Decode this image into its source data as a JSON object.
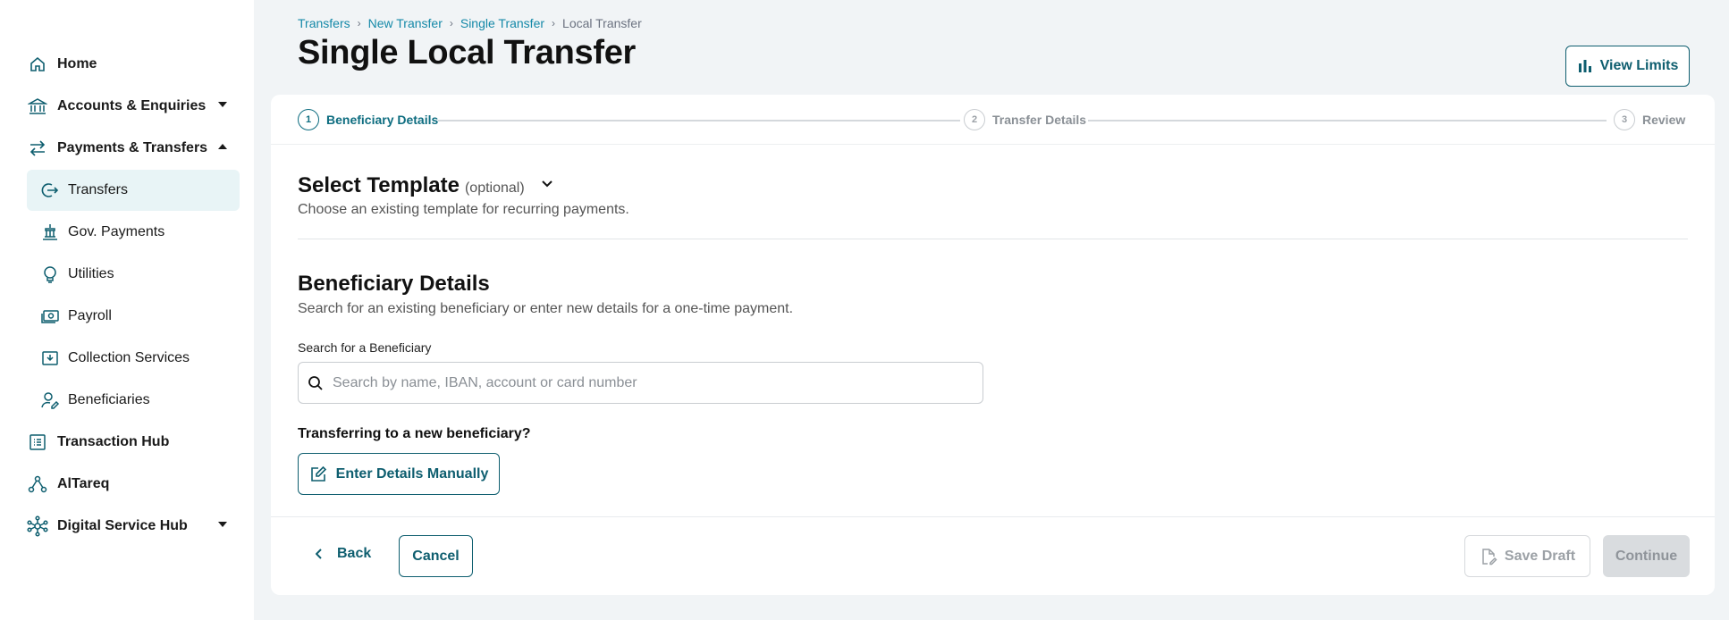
{
  "sidebar": {
    "items": [
      {
        "label": "Home",
        "icon": "home-icon"
      },
      {
        "label": "Accounts & Enquiries",
        "icon": "bank-icon"
      },
      {
        "label": "Payments & Transfers",
        "icon": "transfer-arrows-icon"
      },
      {
        "label": "Transfers",
        "icon": "transfer-circle-icon"
      },
      {
        "label": "Gov. Payments",
        "icon": "government-icon"
      },
      {
        "label": "Utilities",
        "icon": "lightbulb-icon"
      },
      {
        "label": "Payroll",
        "icon": "cash-icon"
      },
      {
        "label": "Collection Services",
        "icon": "collection-icon"
      },
      {
        "label": "Beneficiaries",
        "icon": "beneficiary-icon"
      },
      {
        "label": "Transaction Hub",
        "icon": "list-icon"
      },
      {
        "label": "AlTareq",
        "icon": "network-icon"
      },
      {
        "label": "Digital Service Hub",
        "icon": "hub-icon"
      }
    ]
  },
  "breadcrumb": [
    "Transfers",
    "New Transfer",
    "Single Transfer",
    "Local Transfer"
  ],
  "page": {
    "title": "Single Local Transfer",
    "view_limits": "View Limits"
  },
  "stepper": [
    {
      "num": "1",
      "label": "Beneficiary Details"
    },
    {
      "num": "2",
      "label": "Transfer Details"
    },
    {
      "num": "3",
      "label": "Review"
    }
  ],
  "template": {
    "title": "Select Template",
    "optional": "(optional)",
    "subtitle": "Choose an existing template for recurring payments."
  },
  "beneficiary": {
    "title": "Beneficiary Details",
    "subtitle": "Search for an existing beneficiary or enter new details for a one-time payment.",
    "search_label": "Search for a Beneficiary",
    "search_placeholder": "Search by name, IBAN, account or card number",
    "new_question": "Transferring to a new beneficiary?",
    "manual_button": "Enter Details Manually"
  },
  "footer": {
    "back": "Back",
    "cancel": "Cancel",
    "save_draft": "Save Draft",
    "continue": "Continue"
  },
  "colors": {
    "accent": "#0e5e6f",
    "link": "#1589a8",
    "active_bg": "#e8f4f6",
    "page_bg": "#f1f4f6"
  }
}
